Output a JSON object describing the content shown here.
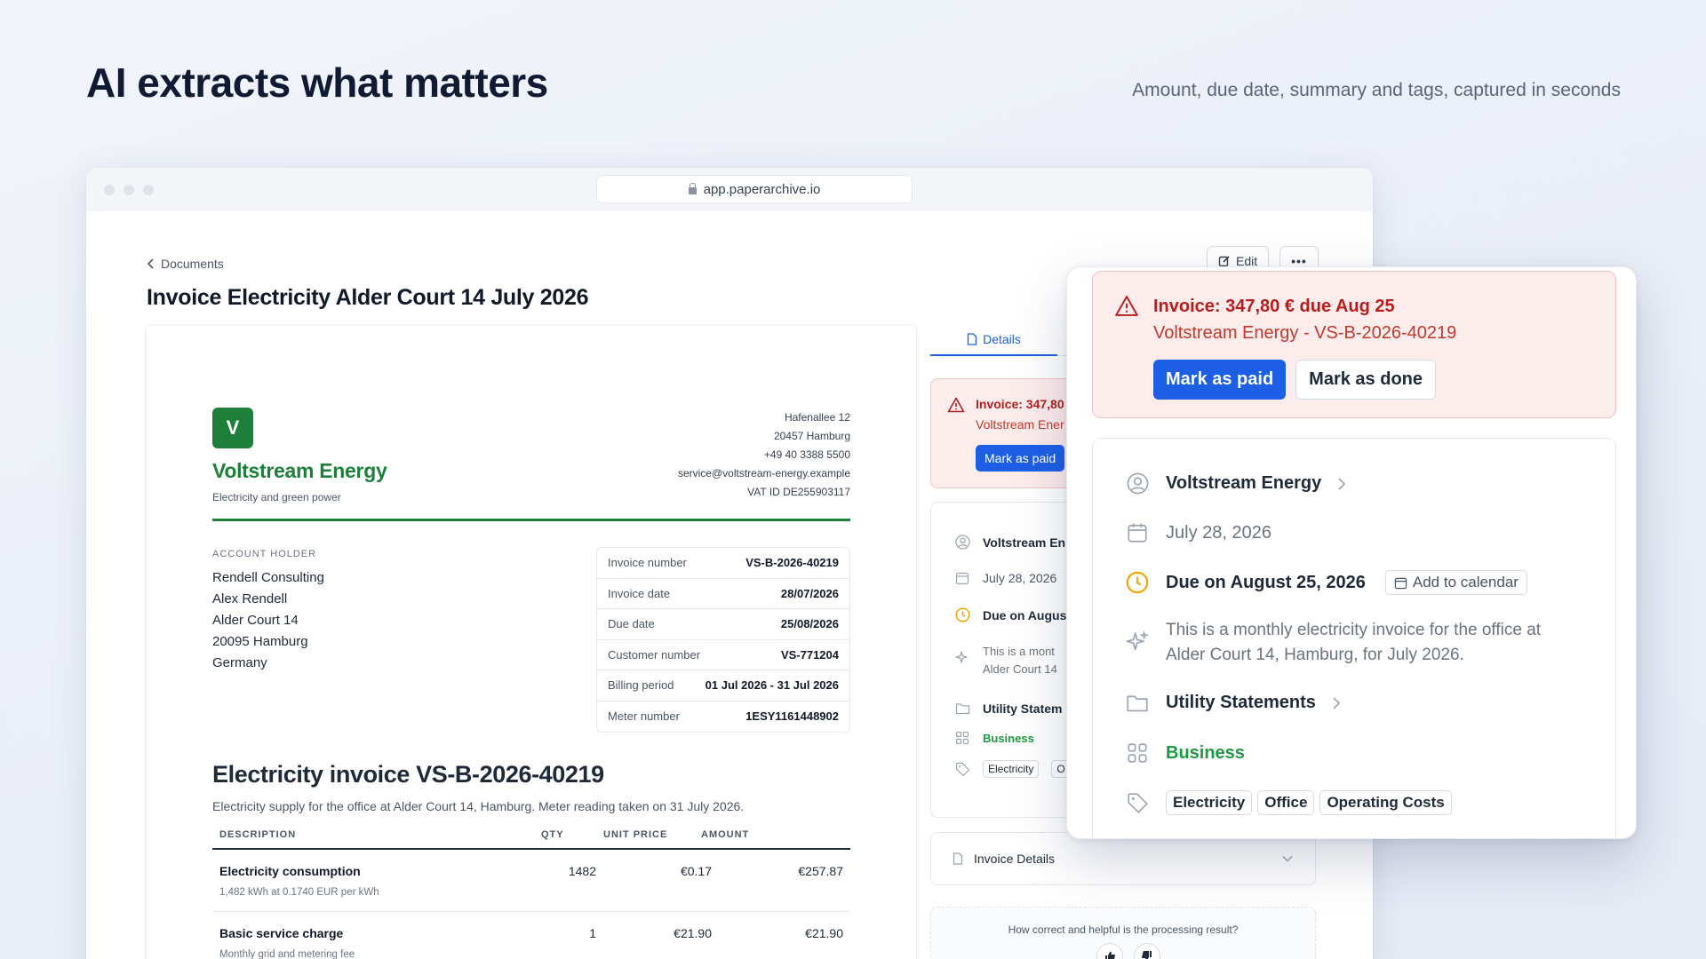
{
  "hero": {
    "title": "AI extracts what matters",
    "subtitle": "Amount, due date, summary and tags, captured in seconds"
  },
  "browser": {
    "url": "app.paperarchive.io"
  },
  "page": {
    "breadcrumb": "Documents",
    "title": "Invoice Electricity Alder Court 14 July 2026",
    "edit_label": "Edit"
  },
  "invoice": {
    "logo_letter": "V",
    "brand": "Voltstream Energy",
    "tagline": "Electricity and green power",
    "sender": {
      "street": "Hafenallee 12",
      "city": "20457 Hamburg",
      "phone": "+49 40 3388 5500",
      "email": "service@voltstream-energy.example",
      "vat": "VAT ID DE255903117"
    },
    "account_label": "ACCOUNT HOLDER",
    "account": {
      "company": "Rendell Consulting",
      "name": "Alex Rendell",
      "street": "Alder Court 14",
      "city": "20095 Hamburg",
      "country": "Germany"
    },
    "meta": [
      {
        "k": "Invoice number",
        "v": "VS-B-2026-40219"
      },
      {
        "k": "Invoice date",
        "v": "28/07/2026"
      },
      {
        "k": "Due date",
        "v": "25/08/2026"
      },
      {
        "k": "Customer number",
        "v": "VS-771204"
      },
      {
        "k": "Billing period",
        "v": "01 Jul 2026 - 31 Jul 2026"
      },
      {
        "k": "Meter number",
        "v": "1ESY1161448902"
      }
    ],
    "heading": "Electricity invoice VS-B-2026-40219",
    "description": "Electricity supply for the office at Alder Court 14, Hamburg. Meter reading taken on 31 July 2026.",
    "columns": {
      "desc": "DESCRIPTION",
      "qty": "QTY",
      "unit": "UNIT PRICE",
      "amount": "AMOUNT"
    },
    "items": [
      {
        "name": "Electricity consumption",
        "sub": "1,482 kWh at 0.1740 EUR per kWh",
        "qty": "1482",
        "unit": "€0.17",
        "amount": "€257.87"
      },
      {
        "name": "Basic service charge",
        "sub": "Monthly grid and metering fee",
        "qty": "1",
        "unit": "€21.90",
        "amount": "€21.90"
      }
    ]
  },
  "panel": {
    "tab_details": "Details",
    "alert_title_short": "Invoice: 347,80",
    "alert_sub_short": "Voltstream Ener",
    "mark_paid": "Mark as paid",
    "vendor_short": "Voltstream En",
    "date_short": "July 28, 2026",
    "due_short": "Due on Augus",
    "summary_short_1": "This is a mont",
    "summary_short_2": "Alder Court 14",
    "folder_short": "Utility Statem",
    "category": "Business",
    "tag_short_1": "Electricity",
    "tag_short_2": "O",
    "invoice_details": "Invoice Details",
    "feedback_q": "How correct and helpful is the processing result?"
  },
  "zoom": {
    "alert_title": "Invoice: 347,80 € due Aug 25",
    "alert_sub": "Voltstream Energy - VS-B-2026-40219",
    "mark_paid": "Mark as paid",
    "mark_done": "Mark as done",
    "vendor": "Voltstream Energy",
    "date": "July 28, 2026",
    "due": "Due on August 25, 2026",
    "add_calendar": "Add to calendar",
    "summary": "This is a monthly electricity invoice for the office at Alder Court 14, Hamburg, for July 2026.",
    "folder": "Utility Statements",
    "category": "Business",
    "tags": [
      "Electricity",
      "Office",
      "Operating Costs"
    ]
  },
  "colors": {
    "accent": "#1c5fe5",
    "brand_green": "#1d7f3a",
    "alert_bg": "#fdecec",
    "alert_text": "#b91c1c",
    "due_icon": "#f0a500"
  }
}
